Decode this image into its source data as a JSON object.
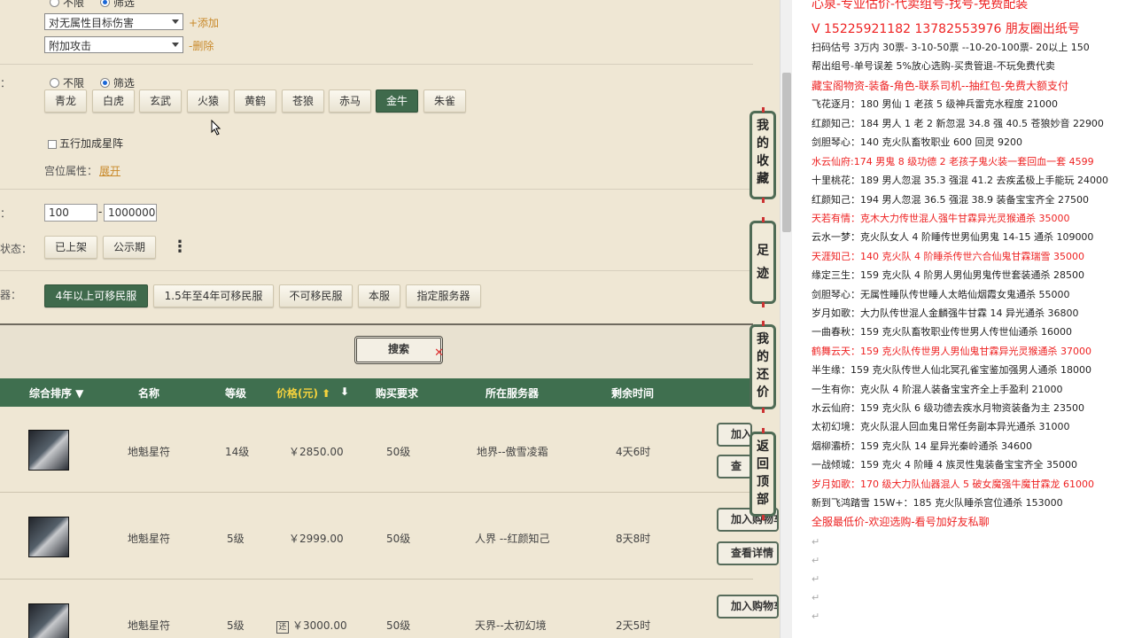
{
  "filters": {
    "top_radio": {
      "unlimited": "不限",
      "filter": "筛选"
    },
    "select1": "对无属性目标伤害",
    "add_link": "+添加",
    "select2": "附加攻击",
    "delete_link": "-删除",
    "stars": {
      "label": "：",
      "unlimited": "不限",
      "filter": "筛选",
      "options": [
        "青龙",
        "白虎",
        "玄武",
        "火猿",
        "黄鹤",
        "苍狼",
        "赤马",
        "金牛",
        "朱雀"
      ],
      "active": "金牛"
    },
    "five_elements": "五行加成星阵",
    "palace_label": "宫位属性：",
    "expand_link": "展开",
    "price_label": "：",
    "price_min": "100",
    "price_sep": "-",
    "price_max": "1000000",
    "status_label": "状态：",
    "status_options": [
      "已上架",
      "公示期"
    ],
    "more": "⋮",
    "server_label": "器：",
    "server_options": [
      "4年以上可移民服",
      "1.5年至4年可移民服",
      "不可移民服",
      "本服",
      "指定服务器"
    ],
    "server_active": "4年以上可移民服"
  },
  "search_button": "搜索",
  "table": {
    "headers": {
      "sort": "综合排序 ▼",
      "name": "名称",
      "level": "等级",
      "price": "价格(元) ⬆",
      "price_down": "⬇",
      "req": "购买要求",
      "server": "所在服务器",
      "time": "剩余时间"
    },
    "rows": [
      {
        "name": "地魁星符",
        "level": "14级",
        "price": "￥2850.00",
        "req": "50级",
        "server": "地界--傲雪凌霜",
        "time": "4天6时",
        "tag": "",
        "btn1": "加入",
        "btn2": "查"
      },
      {
        "name": "地魁星符",
        "level": "5级",
        "price": "￥2999.00",
        "req": "50级",
        "server": "人界 --红颜知己",
        "time": "8天8时",
        "tag": "",
        "btn1": "加入购物车",
        "btn2": "查看详情"
      },
      {
        "name": "地魁星符",
        "level": "5级",
        "price": "￥3000.00",
        "req": "50级",
        "server": "天界--太初幻境",
        "time": "2天5时",
        "tag": "还",
        "btn1": "加入购物车",
        "btn2": ""
      }
    ]
  },
  "side_tabs": [
    "我的收藏",
    "足迹",
    "我的还价",
    "返回顶部"
  ],
  "right_panel": {
    "header": "心泉-专业估价-代卖组号-找号-免费配装",
    "contact": "V 15225921182   13782553976 朋友圈出纸号",
    "lines": [
      {
        "text": "扫码估号 3万内 30票- 3-10-50票  --10-20-100票- 20以上 150",
        "red": false
      },
      {
        "text": "帮出组号-单号误差 5%放心选购-买贵管退-不玩免费代卖",
        "red": false
      },
      {
        "text": "藏宝阁物资-装备-角色-联系司机--抽红包-免费大额支付",
        "red": true,
        "big": true
      },
      {
        "text": "飞花逐月：180 男仙 1 老孩 5 级神兵雷克水程度 21000",
        "red": false
      },
      {
        "text": "红颜知己：184 男人 1 老 2 新忽混 34.8 强 40.5 苍狼妙音 22900",
        "red": false
      },
      {
        "text": "剑胆琴心：140 克火队畜牧职业 600 回灵 9200",
        "red": false
      },
      {
        "text": "水云仙府:174 男鬼 8 级功德 2 老孩子鬼火装一套回血一套 4599",
        "red": true
      },
      {
        "text": "十里桃花：189 男人忽混 35.3 强混 41.2 去疾孟极上手能玩 24000",
        "red": false
      },
      {
        "text": "红颜知己：194 男人忽混 36.5 强混 38.9 装备宝宝齐全 27500",
        "red": false
      },
      {
        "text": "天若有情：克木大力传世混人强牛甘霖异光灵猴通杀 35000",
        "red": true
      },
      {
        "text": "云水一梦：克火队女人 4 阶睡传世男仙男鬼 14-15 通杀 109000",
        "red": false
      },
      {
        "text": "天涯知己：140 克火队 4 阶睡杀传世六合仙鬼甘霖瑞雪 35000",
        "red": true
      },
      {
        "text": "缘定三生：159 克火队 4 阶男人男仙男鬼传世套装通杀 28500",
        "red": false
      },
      {
        "text": "剑胆琴心：无属性睡队传世睡人太皓仙烟霞女鬼通杀 55000",
        "red": false
      },
      {
        "text": "岁月如歌：大力队传世混人金麟强牛甘霖 14 异光通杀 36800",
        "red": false
      },
      {
        "text": "一曲春秋：159 克火队畜牧职业传世男人传世仙通杀 16000",
        "red": false
      },
      {
        "text": "鹤舞云天：159 克火队传世男人男仙鬼甘霖异光灵猴通杀 37000",
        "red": true
      },
      {
        "text": "半生缘：159 克火队传世人仙北冥孔雀宝鉴加强男人通杀 18000",
        "red": false
      },
      {
        "text": "一生有你：克火队 4 阶混人装备宝宝齐全上手盈利 21000",
        "red": false
      },
      {
        "text": "水云仙府：159 克火队 6 级功德去疾水月物资装备为主 23500",
        "red": false
      },
      {
        "text": "太初幻境：克火队混人回血鬼日常任务副本异光通杀 31000",
        "red": false
      },
      {
        "text": "烟柳灞桥：159 克火队 14 星异光秦岭通杀 34600",
        "red": false
      },
      {
        "text": "一战倾城：159 克火 4 阶睡 4 族灵性鬼装备宝宝齐全 35000",
        "red": false
      },
      {
        "text": "岁月如歌：170 级大力队仙器混人 5 破女魔强牛魔甘霖龙 61000",
        "red": true
      },
      {
        "text": "新到飞鸿踏雪 15W+：185 克火队睡杀宫位通杀 153000",
        "red": false
      },
      {
        "text": "全服最低价-欢迎选购-看号加好友私聊",
        "red": true,
        "big": true
      }
    ]
  }
}
